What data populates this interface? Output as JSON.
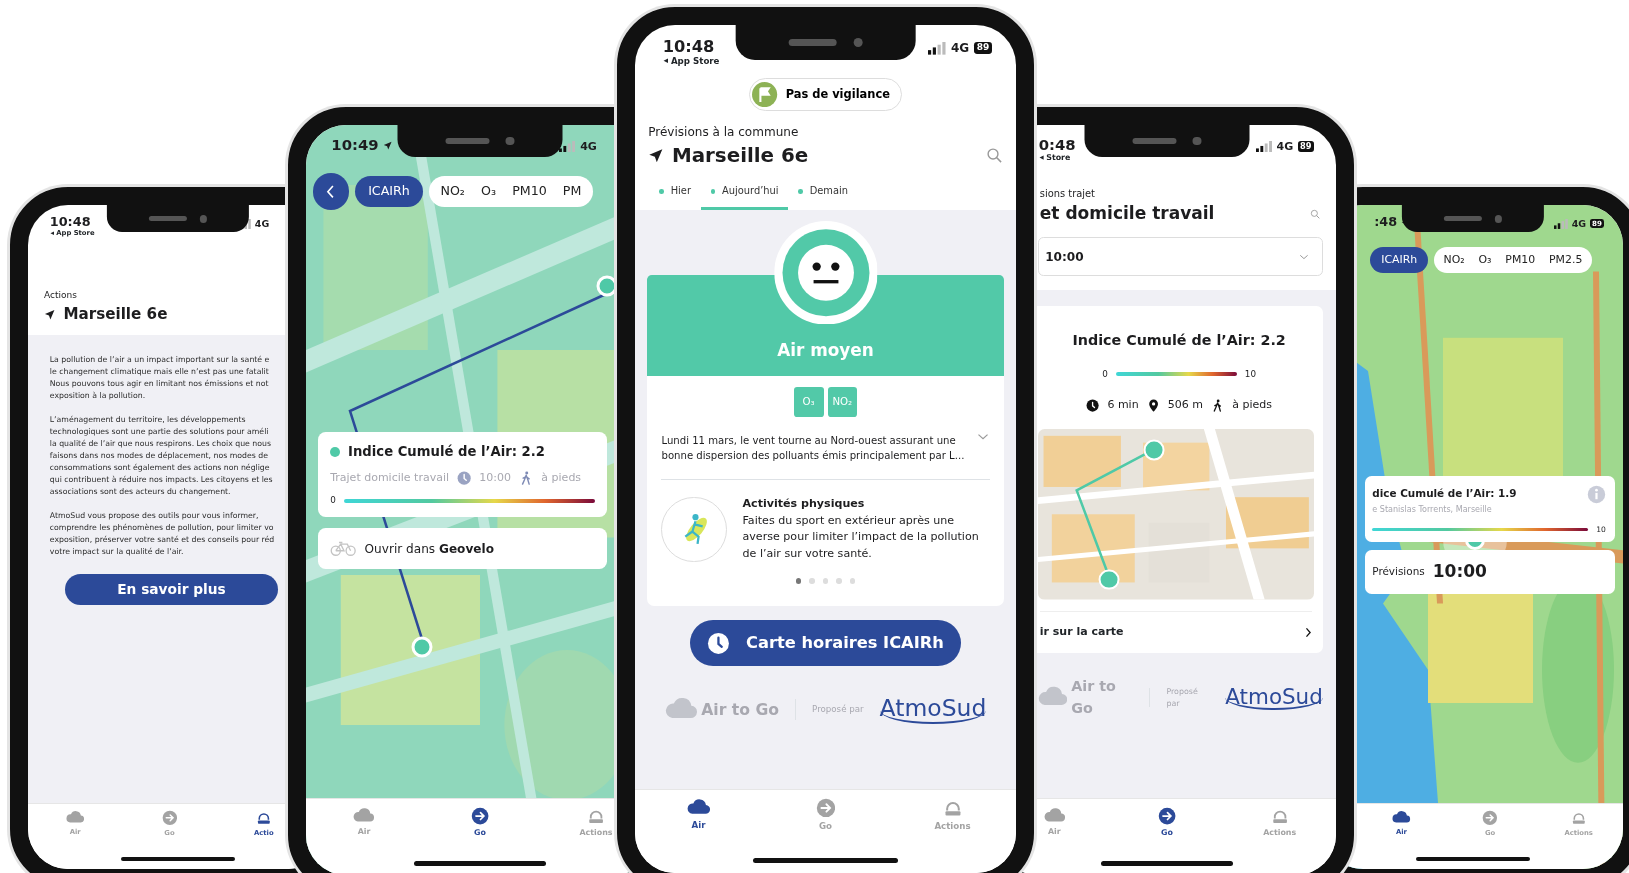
{
  "phones": [
    {
      "kind": "actions",
      "status": {
        "time": "10:48",
        "back_label": "App Store",
        "network": "4G"
      },
      "header": {
        "label": "Actions",
        "location": "Marseille 6e"
      },
      "paragraphs": [
        [
          "La pollution de l’air a un impact important sur la santé e",
          "le changement climatique mais elle n’est pas une fatalit",
          "Nous pouvons tous agir en limitant nos émissions et not",
          "exposition à la pollution."
        ],
        [
          "L’aménagement du territoire, les développements",
          "technologiques sont une partie des solutions pour améli",
          "la qualité de l’air que nous respirons. Les choix que nous",
          "faisons dans nos modes de déplacement, nos modes de",
          "consommations sont également des actions non néglige",
          "qui contribuent à réduire nos impacts. Les citoyens et les",
          "associations sont des acteurs du changement."
        ],
        [
          "AtmoSud vous propose des outils pour vous informer,",
          "comprendre les phénomènes de pollution, pour limiter vo",
          "exposition, préserver votre santé et des conseils pour réd",
          "votre impact sur la qualité de l’air."
        ]
      ],
      "button": "En savoir plus",
      "tabs": [
        {
          "label": "Air",
          "selected": false
        },
        {
          "label": "Go",
          "selected": false
        },
        {
          "label": "Actio",
          "selected": true
        }
      ]
    },
    {
      "kind": "map_route",
      "status": {
        "time": "10:49",
        "network": "4G"
      },
      "map": {
        "kind": "picture"
      },
      "pollutants": [
        {
          "label": "ICAIRh",
          "selected": true
        },
        {
          "label": "NO₂",
          "selected": false
        },
        {
          "label": "O₃",
          "selected": false
        },
        {
          "label": "PM10",
          "selected": false
        },
        {
          "label": "PM",
          "selected": false
        }
      ],
      "index_card": {
        "title": "Indice Cumulé de l’Air: 2.2",
        "route": "Trajet domicile travail",
        "time": "10:00",
        "mode": "à pieds",
        "scale_min": "0"
      },
      "open_card": {
        "text": "Ouvrir dans **Geovelo**"
      },
      "tabs": [
        {
          "label": "Air",
          "selected": false
        },
        {
          "label": "Go",
          "selected": true
        },
        {
          "label": "Actions",
          "selected": false
        }
      ]
    },
    {
      "kind": "forecast",
      "status": {
        "time": "10:48",
        "back_label": "App Store",
        "network": "4G",
        "battery": "89"
      },
      "vigilance": "Pas de vigilance",
      "header": {
        "label": "Prévisions à la commune",
        "location": "Marseille 6e"
      },
      "days": [
        {
          "label": "Hier",
          "selected": false
        },
        {
          "label": "Aujourd’hui",
          "selected": true
        },
        {
          "label": "Demain",
          "selected": false
        }
      ],
      "air_quality": "Air moyen",
      "pollutants": [
        "O₃",
        "NO₂"
      ],
      "description": "Lundi 11 mars, le vent tourne au Nord-ouest assurant une bonne dispersion des polluants émis principalement par L...",
      "advice": {
        "title": "Activités physiques",
        "text": "Faites du sport en extérieur après une averse pour limiter l’impact de la pollution de l’air sur votre santé."
      },
      "pages": [
        {
          "selected": true
        },
        {
          "selected": false
        },
        {
          "selected": false
        },
        {
          "selected": false
        },
        {
          "selected": false
        }
      ],
      "button": "Carte horaires ICAIRh",
      "footer": {
        "app_name": "Air to Go",
        "proposed_by": "Proposé par",
        "partner": "AtmoSud"
      },
      "tabs": [
        {
          "label": "Air",
          "selected": true
        },
        {
          "label": "Go",
          "selected": false
        },
        {
          "label": "Actions",
          "selected": false
        }
      ]
    },
    {
      "kind": "route_forecast",
      "status": {
        "time": "0:48",
        "back_label": "Store",
        "network": "4G",
        "battery": "89"
      },
      "header": {
        "label": "sions trajet",
        "title": "et domicile travail"
      },
      "time_select": "10:00",
      "index": {
        "title": "Indice Cumulé de l’Air: 2.2",
        "scale_min": "0",
        "scale_max": "10",
        "duration": "6 min",
        "distance": "506 m",
        "mode": "à pieds"
      },
      "map": {
        "kind": "picture"
      },
      "map_link": "ir sur la carte",
      "footer": {
        "app_name": "Air to Go",
        "proposed_by": "Proposé par",
        "partner": "AtmoSud"
      },
      "tabs": [
        {
          "label": "Air",
          "selected": false
        },
        {
          "label": "Go",
          "selected": true
        },
        {
          "label": "Actions",
          "selected": false
        }
      ]
    },
    {
      "kind": "map_area",
      "status": {
        "time": ":48",
        "network": "4G",
        "battery": "89"
      },
      "map": {
        "kind": "picture"
      },
      "pollutants": [
        {
          "label": "ICAIRh",
          "selected": true
        },
        {
          "label": "NO₂",
          "selected": false
        },
        {
          "label": "O₃",
          "selected": false
        },
        {
          "label": "PM10",
          "selected": false
        },
        {
          "label": "PM2.5",
          "selected": false
        }
      ],
      "index_card": {
        "title": "dice Cumulé de l’Air: 1.9",
        "address": "e Stanislas Torrents, Marseille",
        "scale_max": "10"
      },
      "forecast": {
        "label": "Prévisions",
        "time": "10:00"
      },
      "tabs": [
        {
          "label": "Air",
          "selected": true
        },
        {
          "label": "Go",
          "selected": false
        },
        {
          "label": "Actions",
          "selected": false
        }
      ]
    }
  ]
}
